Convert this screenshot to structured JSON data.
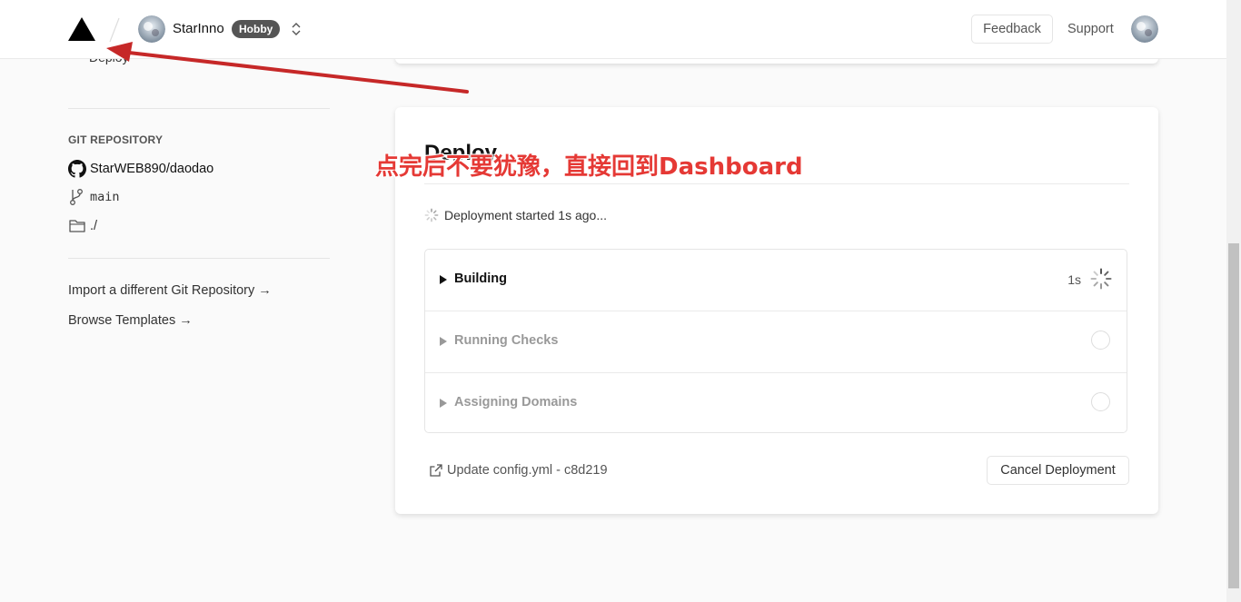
{
  "header": {
    "team_name": "StarInno",
    "plan_badge": "Hobby",
    "feedback_label": "Feedback",
    "support_label": "Support"
  },
  "sidebar": {
    "partial_label": "Deploy",
    "git_heading": "GIT REPOSITORY",
    "repo": "StarWEB890/daodao",
    "branch": "main",
    "root_directory": "./",
    "links": [
      "Import a different Git Repository →",
      "Browse Templates →"
    ]
  },
  "deploy_card": {
    "title": "Deploy",
    "status_text": "Deployment started 1s ago...",
    "steps": [
      {
        "label": "Building",
        "time": "1s",
        "state": "running"
      },
      {
        "label": "Running Checks",
        "state": "pending"
      },
      {
        "label": "Assigning Domains",
        "state": "pending"
      }
    ],
    "commit_label": "Update config.yml - c8d219",
    "cancel_label": "Cancel Deployment"
  },
  "annotation": {
    "text": "点完后不要犹豫，直接回到Dashboard",
    "color": "#e53935"
  },
  "colors": {
    "accent_annotation": "#e53935",
    "badge_bg": "#555555",
    "page_bg": "#fafafa"
  }
}
